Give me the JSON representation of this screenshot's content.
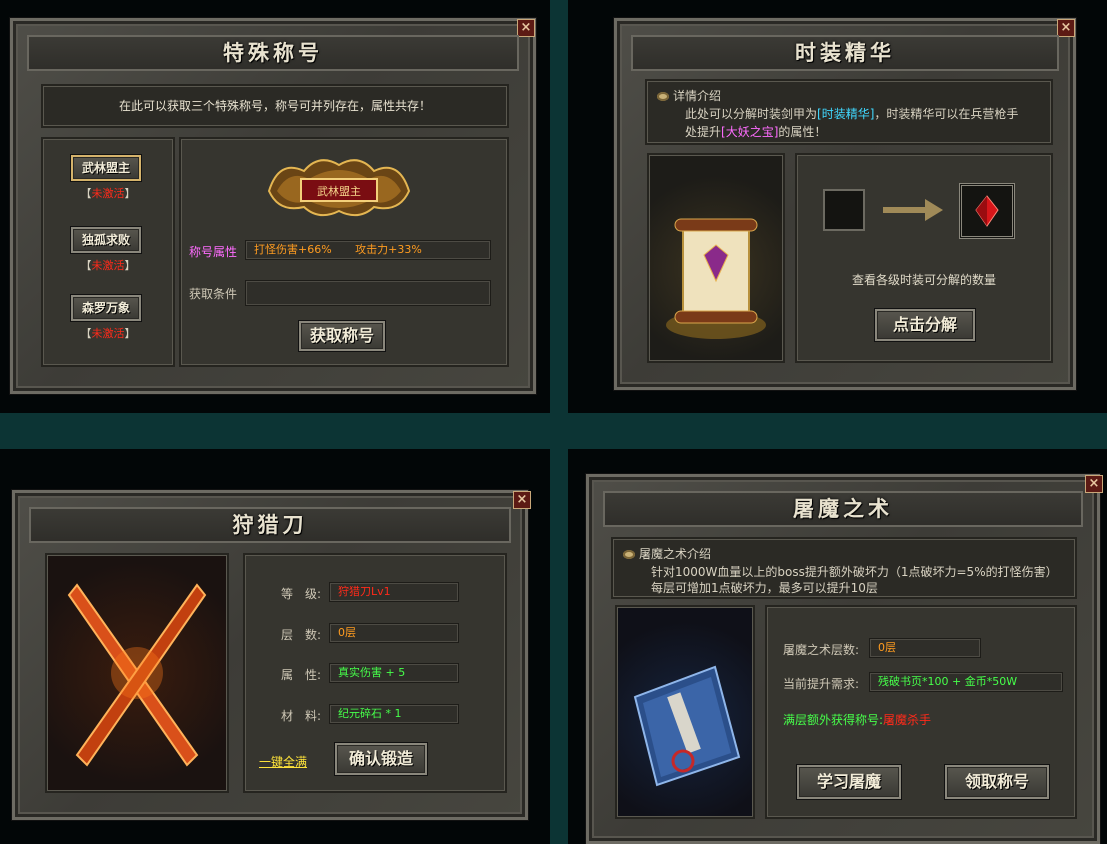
{
  "p1": {
    "title": "特殊称号",
    "close": "×",
    "info": "在此可以获取三个特殊称号，称号可并列存在，属性共存！",
    "titles": [
      {
        "name": "武林盟主",
        "status": "未激活"
      },
      {
        "name": "独孤求败",
        "status": "未激活"
      },
      {
        "name": "森罗万象",
        "status": "未激活"
      }
    ],
    "bracket_l": "【",
    "bracket_r": "】",
    "plaque": "武林盟主",
    "attr_label": "称号属性",
    "attr1": "打怪伤害+66%",
    "attr2": "攻击力+33%",
    "cond_label": "获取条件",
    "button": "获取称号"
  },
  "p2": {
    "title": "时装精华",
    "close": "×",
    "intro_title": "详情介绍",
    "desc1a": "此处可以分解时装剑甲为",
    "desc1b": "[时装精华]",
    "desc1c": "，时装精华可以在兵营枪手",
    "desc2a": "处提升",
    "desc2b": "[大妖之宝]",
    "desc2c": "的属性！",
    "hint": "查看各级时装可分解的数量",
    "button": "点击分解"
  },
  "p3": {
    "title": "狩猎刀",
    "close": "×",
    "rows": [
      {
        "label": "等　级:",
        "value": "狩猎刀Lv1"
      },
      {
        "label": "层　数:",
        "value": "0层"
      },
      {
        "label": "属　性:",
        "value": "真实伤害 + 5"
      },
      {
        "label": "材　料:",
        "value": "纪元碎石 * 1"
      }
    ],
    "link": "一键全满",
    "button": "确认锻造"
  },
  "p4": {
    "title": "屠魔之术",
    "close": "×",
    "intro_title": "屠魔之术介绍",
    "desc1": "针对1000W血量以上的boss提升额外破坏力（1点破坏力=5%的打怪伤害）",
    "desc2": "每层可增加1点破坏力，最多可以提升10层",
    "layer_label": "屠魔之术层数:",
    "layer_value": "0层",
    "req_label": "当前提升需求:",
    "req_value": "残破书页*100 + 金币*50W",
    "bonus_label": "满层额外获得称号:",
    "bonus_value": "屠魔杀手",
    "btn_learn": "学习屠魔",
    "btn_claim": "领取称号"
  }
}
